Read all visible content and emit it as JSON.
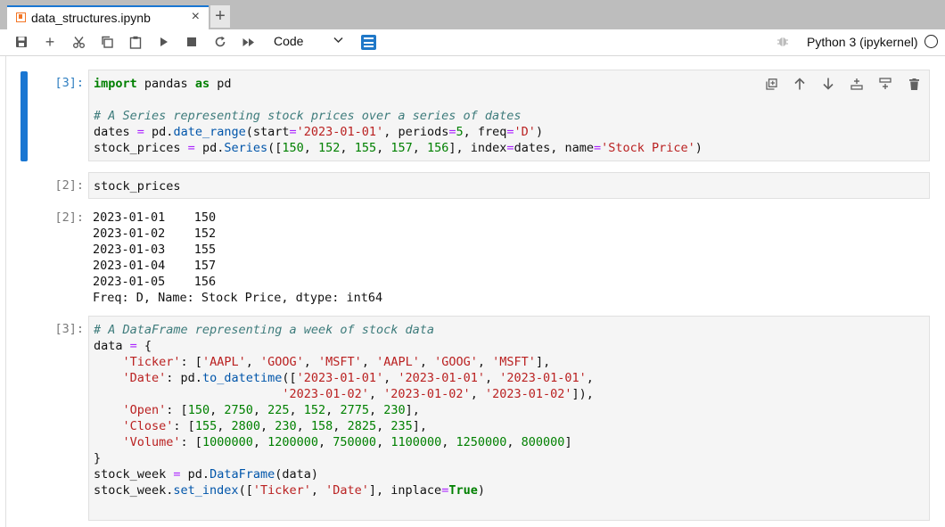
{
  "tab": {
    "title": "data_structures.ipynb",
    "close": "×",
    "add": "+"
  },
  "toolbar": {
    "cell_type": "Code",
    "kernel_name": "Python 3 (ipykernel)"
  },
  "cells": [
    {
      "prompt": "[3]:"
    },
    {
      "prompt": "[2]:",
      "output_prompt": "[2]:"
    },
    {
      "prompt": "[3]:"
    }
  ],
  "cell1": {
    "line1": [
      "import",
      " pandas ",
      "as",
      " pd"
    ],
    "line3": "# A Series representing stock prices over a series of dates",
    "line4": [
      "dates ",
      "=",
      " pd.",
      "date_range",
      "(start",
      "=",
      "'2023-01-01'",
      ", periods",
      "=",
      "5",
      ", freq",
      "=",
      "'D'",
      ")"
    ],
    "line5": [
      "stock_prices ",
      "=",
      " pd.",
      "Series",
      "([",
      "150",
      ", ",
      "152",
      ", ",
      "155",
      ", ",
      "157",
      ", ",
      "156",
      "], index",
      "=",
      "dates, name",
      "=",
      "'Stock Price'",
      ")"
    ]
  },
  "cell2": {
    "code": "stock_prices",
    "output": "2023-01-01    150\n2023-01-02    152\n2023-01-03    155\n2023-01-04    157\n2023-01-05    156\nFreq: D, Name: Stock Price, dtype: int64"
  },
  "cell3": {
    "l1": "# A DataFrame representing a week of stock data",
    "l2": [
      "data ",
      "=",
      " {"
    ],
    "l3": [
      "    ",
      "'Ticker'",
      ": [",
      "'AAPL'",
      ", ",
      "'GOOG'",
      ", ",
      "'MSFT'",
      ", ",
      "'AAPL'",
      ", ",
      "'GOOG'",
      ", ",
      "'MSFT'",
      "],"
    ],
    "l4": [
      "    ",
      "'Date'",
      ": pd.",
      "to_datetime",
      "([",
      "'2023-01-01'",
      ", ",
      "'2023-01-01'",
      ", ",
      "'2023-01-01'",
      ","
    ],
    "l5": [
      "                          ",
      "'2023-01-02'",
      ", ",
      "'2023-01-02'",
      ", ",
      "'2023-01-02'",
      "]),"
    ],
    "l6": [
      "    ",
      "'Open'",
      ": [",
      "150",
      ", ",
      "2750",
      ", ",
      "225",
      ", ",
      "152",
      ", ",
      "2775",
      ", ",
      "230",
      "],"
    ],
    "l7": [
      "    ",
      "'Close'",
      ": [",
      "155",
      ", ",
      "2800",
      ", ",
      "230",
      ", ",
      "158",
      ", ",
      "2825",
      ", ",
      "235",
      "],"
    ],
    "l8": [
      "    ",
      "'Volume'",
      ": [",
      "1000000",
      ", ",
      "1200000",
      ", ",
      "750000",
      ", ",
      "1100000",
      ", ",
      "1250000",
      ", ",
      "800000",
      "]"
    ],
    "l9": "}",
    "l10": [
      "stock_week ",
      "=",
      " pd.",
      "DataFrame",
      "(data)"
    ],
    "l11": [
      "stock_week.",
      "set_index",
      "([",
      "'Ticker'",
      ", ",
      "'Date'",
      "], inplace",
      "=",
      "True",
      ")"
    ]
  }
}
